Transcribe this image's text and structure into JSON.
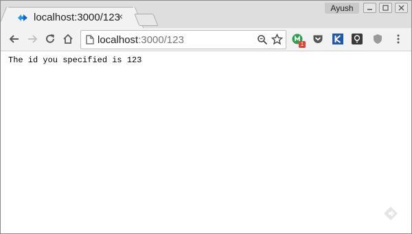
{
  "window": {
    "profile_name": "Ayush"
  },
  "tab": {
    "title": "localhost:3000/123",
    "close_glyph": "×",
    "favicon": "diamond-favicon-icon"
  },
  "toolbar": {
    "url_host": "localhost",
    "url_path": ":3000/123",
    "extensions_badge": "1"
  },
  "page": {
    "text": "The id you specified is 123"
  },
  "colors": {
    "accent": "#2196f3",
    "badge": "#d9463b",
    "ext_green": "#2e9e4f",
    "ext_blue": "#1e5aa8"
  }
}
